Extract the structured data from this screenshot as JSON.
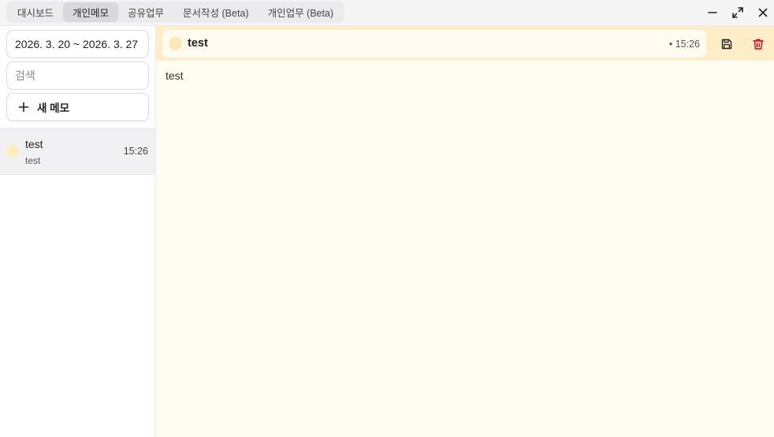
{
  "tabs": [
    {
      "label": "대시보드",
      "active": false
    },
    {
      "label": "개인메모",
      "active": true
    },
    {
      "label": "공유업무",
      "active": false
    },
    {
      "label": "문서작성 (Beta)",
      "active": false
    },
    {
      "label": "개인업무 (Beta)",
      "active": false
    }
  ],
  "window_controls": [
    "minimize-icon",
    "maximize-icon",
    "close-icon"
  ],
  "sidebar": {
    "date_range": "2026. 3. 20 ~ 2026. 3. 27",
    "search_placeholder": "검색",
    "new_memo_label": "새 메모",
    "memos": [
      {
        "title": "test",
        "preview": "test",
        "time": "15:26",
        "color": "#ffeec0"
      }
    ]
  },
  "editor": {
    "title": "test",
    "time": "• 15:26",
    "content": "test",
    "header_color": "#ffedc7",
    "background_color": "#fffcf1",
    "save_icon": "save-icon",
    "delete_icon": "trash-icon",
    "delete_color": "#d0021b"
  }
}
